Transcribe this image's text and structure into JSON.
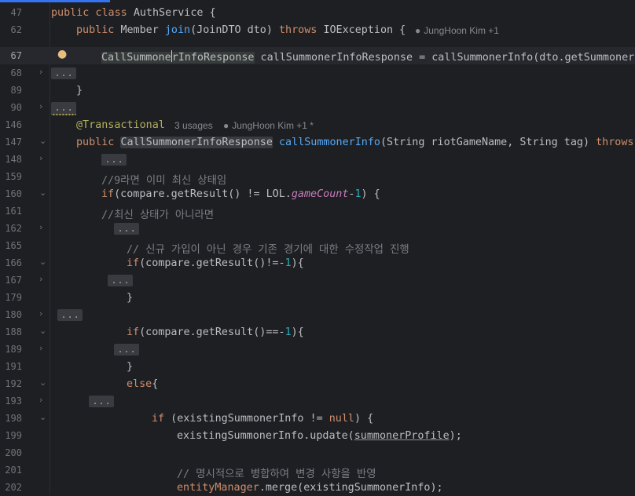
{
  "lines": {
    "l47": {
      "num": "47",
      "class_kw": "public class",
      "class_name": "AuthService {"
    },
    "l62": {
      "num": "62",
      "public": "public",
      "type": "Member",
      "method": "join",
      "params": "(JoinDTO dto)",
      "throws": "throws",
      "exception": "IOException {",
      "author": "JungHoon Kim +1"
    },
    "l67": {
      "num": "67",
      "type_a": "CallSummone",
      "type_b": "rInfoResponse",
      "rest": " callSummonerInfoResponse = callSummonerInfo(dto.getSummonerN"
    },
    "l68": {
      "num": "68",
      "dots": "..."
    },
    "l89": {
      "num": "89",
      "text": "}"
    },
    "l90": {
      "num": "90",
      "dots": "..."
    },
    "l146": {
      "num": "146",
      "annotation": "@Transactional",
      "usages": "3 usages",
      "author": "JungHoon Kim +1 *"
    },
    "l147": {
      "num": "147",
      "public": "public",
      "ret_type": "CallSummonerInfoResponse",
      "method": "callSummonerInfo",
      "params": "(String riotGameName, String tag)",
      "throws": "throws"
    },
    "l148": {
      "num": "148",
      "dots": "..."
    },
    "l159": {
      "num": "159",
      "comment": "//9라면 이미 최신 상태임"
    },
    "l160": {
      "num": "160",
      "if": "if",
      "a": "(compare.getResult() != LOL.",
      "field": "gameCount",
      "b": "-",
      "n": "1",
      "c": ") {"
    },
    "l161": {
      "num": "161",
      "comment": "//최신 상태가 아니라면"
    },
    "l162": {
      "num": "162",
      "dots": "..."
    },
    "l165": {
      "num": "165",
      "comment": "// 신규 가입이 아닌 경우 기존 경기에 대한 수정작업 진행"
    },
    "l166": {
      "num": "166",
      "if": "if",
      "a": "(compare.getResult()!=-",
      "n": "1",
      "c": "){"
    },
    "l167": {
      "num": "167",
      "dots": "..."
    },
    "l179": {
      "num": "179",
      "text": "}"
    },
    "l180": {
      "num": "180",
      "dots": "..."
    },
    "l188": {
      "num": "188",
      "if": "if",
      "a": "(compare.getResult()==-",
      "n": "1",
      "c": "){"
    },
    "l189": {
      "num": "189",
      "dots": "..."
    },
    "l191": {
      "num": "191",
      "text": "}"
    },
    "l192": {
      "num": "192",
      "else": "else",
      "c": "{"
    },
    "l193": {
      "num": "193",
      "dots": "..."
    },
    "l198": {
      "num": "198",
      "if": "if",
      "a": " (existingSummonerInfo != ",
      "null": "null",
      "c": ") {"
    },
    "l199": {
      "num": "199",
      "a": "existingSummonerInfo.update(",
      "arg": "summonerProfile",
      "c": ");"
    },
    "l200": {
      "num": "200"
    },
    "l201": {
      "num": "201",
      "comment": "// 명시적으로 병합하여 변경 사항을 반영"
    },
    "l202": {
      "num": "202",
      "obj": "entityManager",
      "a": ".merge(existingSummonerInfo);"
    }
  },
  "icons": {
    "fold_collapsed": "chevron-right-icon",
    "fold_expanded": "chevron-down-icon",
    "bulb": "lightbulb-icon",
    "person": "person-icon"
  },
  "colors": {
    "background": "#1e1f22",
    "keyword": "#cf8e6d",
    "function": "#56a8f5",
    "annotation": "#b3ae60",
    "number": "#2aacb8",
    "field": "#c77dbb",
    "comment": "#7a7e85",
    "text": "#bcbec4"
  }
}
